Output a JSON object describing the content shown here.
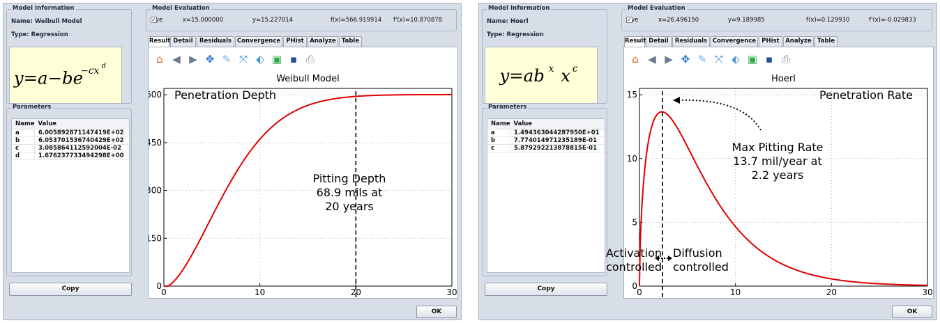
{
  "left": {
    "model_info": {
      "group_title": "Model Information",
      "name_label": "Name: Weibull Model",
      "type_label": "Type:  Regression"
    },
    "parameters": {
      "group_title": "Parameters",
      "columns": [
        "Name",
        "Value"
      ],
      "rows": [
        {
          "name": "a",
          "value": "6.005892871147419E+02"
        },
        {
          "name": "b",
          "value": "6.053701536740429E+02"
        },
        {
          "name": "c",
          "value": "3.085864112592004E-02"
        },
        {
          "name": "d",
          "value": "1.676237733494298E+00"
        }
      ]
    },
    "copy_label": "Copy",
    "evaluation": {
      "group_title": "Model Evaluation",
      "live_label": "Live",
      "x": "x=15.000000",
      "y": "y=15.227014",
      "fx": "f(x)=566.919914",
      "fpx": "f'(x)=10.870878"
    },
    "tabs": [
      "Result",
      "Detail",
      "Residuals",
      "Convergence",
      "PHist",
      "Analyze",
      "Table"
    ],
    "ok_label": "OK",
    "chart_data": {
      "type": "line",
      "title": "Weibull Model",
      "xlabel": "",
      "ylabel": "",
      "xlim": [
        0,
        30
      ],
      "ylim": [
        0,
        620
      ],
      "x_ticks": [
        "0",
        "10",
        "20",
        "30"
      ],
      "y_tick_values": [
        0,
        150,
        300,
        450,
        600
      ],
      "y_ticks": [
        "0",
        "150",
        "300",
        "450",
        "600"
      ],
      "grid": true,
      "series": [
        {
          "name": "",
          "color": "#e00000",
          "model": "weibull",
          "params": {
            "a": 600.5892871147419,
            "b": 605.3701536740429,
            "c": 0.03085864112592004,
            "d": 1.676237733494298
          }
        }
      ],
      "vline_x": 20,
      "annotations": {
        "corner": "Penetration Depth",
        "center_lines": [
          "Pitting Depth",
          "68.9 mils at",
          "20 years"
        ]
      }
    }
  },
  "right": {
    "model_info": {
      "group_title": "Model Information",
      "name_label": "Name: Hoerl",
      "type_label": "Type:  Regression"
    },
    "parameters": {
      "group_title": "Parameters",
      "columns": [
        "Name",
        "Value"
      ],
      "rows": [
        {
          "name": "a",
          "value": "1.494363044287950E+01"
        },
        {
          "name": "b",
          "value": "7.774014971235189E-01"
        },
        {
          "name": "c",
          "value": "5.879292213878815E-01"
        }
      ]
    },
    "copy_label": "Copy",
    "evaluation": {
      "group_title": "Model Evaluation",
      "live_label": "Live",
      "x": "x=26.496150",
      "y": "y=9.189985",
      "fx": "f(x)=0.129930",
      "fpx": "f'(x)=-0.029833"
    },
    "tabs": [
      "Result",
      "Detail",
      "Residuals",
      "Convergence",
      "PHist",
      "Analyze",
      "Table"
    ],
    "ok_label": "OK",
    "chart_data": {
      "type": "line",
      "title": "Hoerl",
      "xlabel": "",
      "ylabel": "",
      "xlim": [
        0,
        30
      ],
      "ylim": [
        0,
        15.5
      ],
      "x_ticks": [
        "0",
        "10",
        "20",
        "30"
      ],
      "y_tick_values": [
        0,
        5,
        10,
        15
      ],
      "y_ticks": [
        "0",
        "5",
        "10",
        "15"
      ],
      "grid": true,
      "series": [
        {
          "name": "",
          "color": "#e00000",
          "model": "hoerl",
          "params": {
            "a": 14.9436304428795,
            "b": 0.7774014971235189,
            "c": 0.5879292213878815
          }
        }
      ],
      "vline_x": 2.4,
      "annotations": {
        "corner": "Penetration Rate",
        "peak_lines": [
          "Max Pitting Rate",
          "13.7 mil/year at",
          "2.2 years"
        ],
        "left_lines": [
          "Activation",
          "controlled"
        ],
        "right_lines": [
          "Diffusion",
          "controlled"
        ]
      }
    }
  },
  "icons": [
    "home-icon",
    "back-icon",
    "forward-icon",
    "pan-icon",
    "edit-icon",
    "zoom-fit-icon",
    "tag-icon",
    "add-image-icon",
    "save-icon",
    "print-icon"
  ]
}
